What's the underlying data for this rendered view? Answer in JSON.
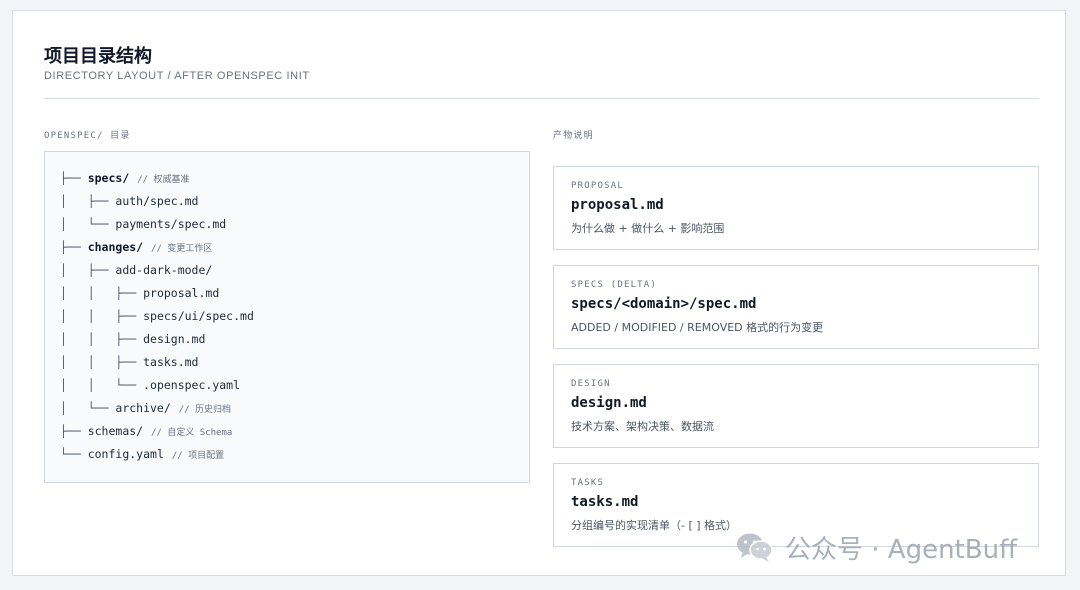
{
  "header": {
    "title": "项目目录结构",
    "subtitle": "DIRECTORY LAYOUT / AFTER OPENSPEC INIT"
  },
  "tree": {
    "label": "OPENSPEC/ 目录",
    "lines": [
      {
        "prefix": "├── ",
        "name": "specs/",
        "bold": true,
        "comment": "// 权威基准"
      },
      {
        "prefix": "│   ├── ",
        "name": "auth/spec.md",
        "bold": false,
        "comment": ""
      },
      {
        "prefix": "│   └── ",
        "name": "payments/spec.md",
        "bold": false,
        "comment": ""
      },
      {
        "prefix": "├── ",
        "name": "changes/",
        "bold": true,
        "comment": "// 变更工作区"
      },
      {
        "prefix": "│   ├── ",
        "name": "add-dark-mode/",
        "bold": false,
        "comment": ""
      },
      {
        "prefix": "│   │   ├── ",
        "name": "proposal.md",
        "bold": false,
        "comment": ""
      },
      {
        "prefix": "│   │   ├── ",
        "name": "specs/ui/spec.md",
        "bold": false,
        "comment": ""
      },
      {
        "prefix": "│   │   ├── ",
        "name": "design.md",
        "bold": false,
        "comment": ""
      },
      {
        "prefix": "│   │   ├── ",
        "name": "tasks.md",
        "bold": false,
        "comment": ""
      },
      {
        "prefix": "│   │   └── ",
        "name": ".openspec.yaml",
        "bold": false,
        "comment": ""
      },
      {
        "prefix": "│   └── ",
        "name": "archive/",
        "bold": false,
        "comment": "// 历史归档"
      },
      {
        "prefix": "├── ",
        "name": "schemas/",
        "bold": false,
        "comment": "// 自定义 Schema"
      },
      {
        "prefix": "└── ",
        "name": "config.yaml",
        "bold": false,
        "comment": "// 项目配置"
      }
    ]
  },
  "artifacts": {
    "label": "产物说明",
    "cards": [
      {
        "tag": "PROPOSAL",
        "file": "proposal.md",
        "desc": "为什么做 + 做什么 + 影响范围"
      },
      {
        "tag": "SPECS (DELTA)",
        "file": "specs/<domain>/spec.md",
        "desc": "ADDED / MODIFIED / REMOVED 格式的行为变更"
      },
      {
        "tag": "DESIGN",
        "file": "design.md",
        "desc": "技术方案、架构决策、数据流"
      },
      {
        "tag": "TASKS",
        "file": "tasks.md",
        "desc": "分组编号的实现清单（- [ ] 格式）"
      }
    ]
  },
  "watermark": {
    "text": "公众号 · AgentBuff",
    "icon": "wechat-icon"
  }
}
